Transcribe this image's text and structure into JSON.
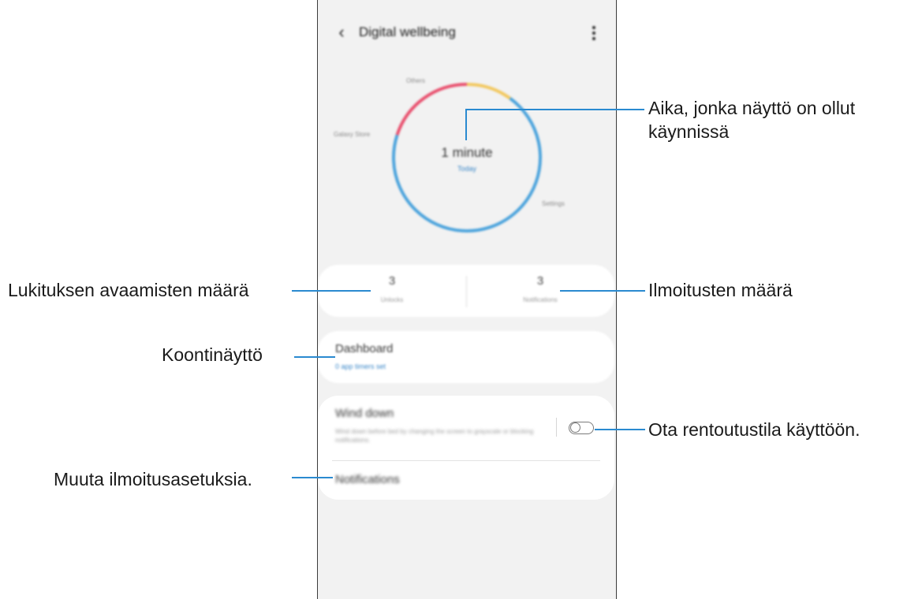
{
  "app": {
    "title": "Digital wellbeing",
    "back_icon": "chevron-left-icon",
    "more_icon": "more-vertical-icon"
  },
  "usage": {
    "time": "1 minute",
    "day": "Today",
    "segments": [
      {
        "label": "Others",
        "color": "#f2c860",
        "fraction": 0.1
      },
      {
        "label": "Settings",
        "color": "#4ba3dc",
        "fraction": 0.7
      },
      {
        "label": "Galaxy Store",
        "color": "#e8506e",
        "fraction": 0.2
      }
    ]
  },
  "stats": {
    "unlocks_value": "3",
    "unlocks_label": "Unlocks",
    "notifications_value": "3",
    "notifications_label": "Notifications"
  },
  "dashboard": {
    "title": "Dashboard",
    "subtitle": "0 app timers set"
  },
  "wind_down": {
    "title": "Wind down",
    "description": "Wind down before bed by changing the screen to grayscale or blocking notifications.",
    "enabled": false
  },
  "notifications": {
    "title": "Notifications"
  },
  "callouts": {
    "screen_time": "Aika, jonka näyttö on ollut käynnissä",
    "unlocks": "Lukituksen avaamisten määrä",
    "notifications_count": "Ilmoitusten määrä",
    "dashboard": "Koontinäyttö",
    "wind_down": "Ota rentoutustila käyttöön.",
    "notification_settings": "Muuta ilmoitusasetuksia."
  },
  "colors": {
    "accent": "#2a8ad0",
    "link": "#3a87c8"
  }
}
